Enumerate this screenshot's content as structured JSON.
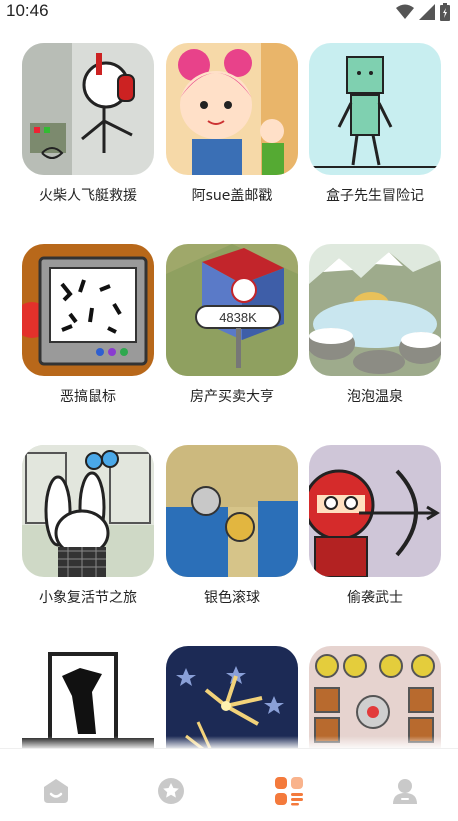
{
  "status_bar": {
    "time": "10:46"
  },
  "games": [
    {
      "title": "火柴人飞艇救援"
    },
    {
      "title": "阿sue盖邮戳"
    },
    {
      "title": "盒子先生冒险记"
    },
    {
      "title": "恶搞鼠标"
    },
    {
      "title": "房产买卖大亨"
    },
    {
      "title": "泡泡温泉"
    },
    {
      "title": "小象复活节之旅"
    },
    {
      "title": "银色滚球"
    },
    {
      "title": "偷袭武士"
    },
    {
      "title": ""
    },
    {
      "title": ""
    },
    {
      "title": ""
    }
  ],
  "thumbnail_text": {
    "price_sign": "4838K"
  },
  "bottom_nav": [
    {
      "icon": "home-icon",
      "active": false
    },
    {
      "icon": "star-icon",
      "active": false
    },
    {
      "icon": "category-icon",
      "active": true
    },
    {
      "icon": "profile-icon",
      "active": false
    }
  ],
  "colors": {
    "accent": "#f47a3c",
    "inactive": "#c9c9c9"
  }
}
